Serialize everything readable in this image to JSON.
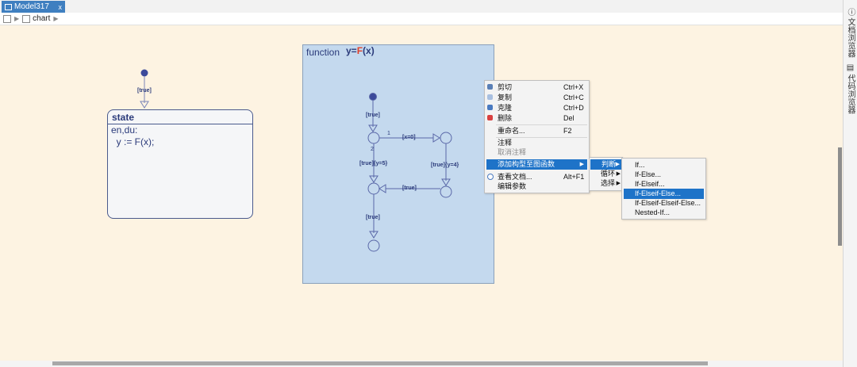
{
  "tab": {
    "title": "Model317",
    "close": "x"
  },
  "breadcrumb": {
    "item": "chart"
  },
  "right_panel": {
    "doc_browser": "文档浏览器",
    "code_browser": "代码浏览器"
  },
  "state": {
    "title": "state",
    "line1": "en,du:",
    "line2": "  y := F(x);",
    "init_label": "[true]"
  },
  "function": {
    "keyword": "function",
    "sig_prefix": "y=",
    "sig_F": "F",
    "sig_suffix": "(x)",
    "labels": {
      "init": "[true]",
      "priority1": "1",
      "priority2": "2",
      "x0": "[x=0]",
      "y4": "[true]{y=4}",
      "y5": "[true]{y=5}",
      "back": "[true]",
      "down": "[true]"
    }
  },
  "context_menu": {
    "items": [
      {
        "label": "剪切",
        "shortcut": "Ctrl+X",
        "icon": "cut-icon",
        "color": "#5a7fb5"
      },
      {
        "label": "复制",
        "shortcut": "Ctrl+C",
        "icon": "copy-icon",
        "color": "#7a9acc"
      },
      {
        "label": "克隆",
        "shortcut": "Ctrl+D",
        "icon": "clone-icon",
        "color": "#4a7ac0"
      },
      {
        "label": "删除",
        "shortcut": "Del",
        "icon": "delete-icon",
        "color": "#d94040"
      },
      {
        "label": "重命名...",
        "shortcut": "F2"
      },
      {
        "label": "注释",
        "shortcut": ""
      },
      {
        "label": "取消注释",
        "shortcut": ""
      },
      {
        "label": "添加构型至图函数",
        "shortcut": ""
      },
      {
        "label": "查看文档...",
        "shortcut": "Alt+F1",
        "icon": "info-icon",
        "color": "#4a7ac0"
      },
      {
        "label": "编辑参数",
        "shortcut": ""
      }
    ]
  },
  "submenu1": {
    "items": [
      "判断",
      "循环",
      "选择"
    ]
  },
  "submenu2": {
    "items": [
      "If...",
      "If-Else...",
      "If-Elseif...",
      "If-Elseif-Else...",
      "If-Elseif-Elseif-Else...",
      "Nested-If..."
    ]
  }
}
